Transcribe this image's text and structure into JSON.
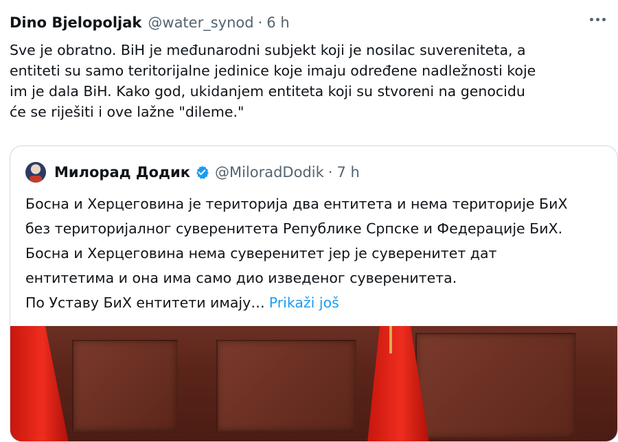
{
  "tweet": {
    "author_name": "Dino Bjelopoljak",
    "handle": "@water_synod",
    "separator": "·",
    "time": "6 h",
    "more_icon": "more-horizontal-icon",
    "text": "Sve je obratno. BiH je međunarodni subjekt koji je nosilac suvereniteta, a\nentiteti su samo teritorijalne jedinice koje imaju određene nadležnosti koje\nim je dala BiH. Kako god, ukidanjem entiteta koji su stvoreni na genocidu\nće se riješiti i ove lažne \"dileme.\""
  },
  "quote": {
    "author_name": "Милорад Додик",
    "verified_icon": "verified-badge-icon",
    "handle": "@MiloradDodik",
    "separator": "·",
    "time": "7 h",
    "lines": [
      "Босна и Херцеговина је територија два ентитета и нема територије БиХ",
      "без територијалног суверенитета Републике Српске и Федерације БиХ.",
      "Босна и Херцеговина нема суверенитет јер је суверенитет дат",
      "ентитетима и она има само дио изведеног суверенитета.",
      "По Уставу БиХ ентитети имају…"
    ],
    "show_more": "Prikaži još",
    "media": "photo of red flags in a wood-panelled room"
  },
  "colors": {
    "text": "#0f1419",
    "secondary": "#536471",
    "link": "#1d9bf0",
    "border": "#cfd9de"
  }
}
